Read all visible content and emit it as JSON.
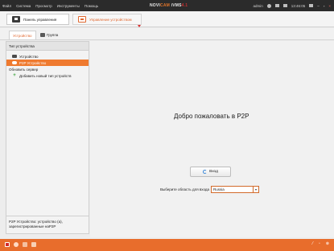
{
  "titlebar": {
    "menu": [
      "Файл",
      "Система",
      "Просмотр",
      "Инструменты",
      "Помощь"
    ],
    "brand": {
      "part1": "NOVI",
      "part2": "CAM",
      "part3": " iVMS",
      "part4": "4.1"
    },
    "user": "admin",
    "time": "13:46:05",
    "controls": {
      "min": "–",
      "max": "▫",
      "close": "×"
    }
  },
  "toolbar": {
    "tab_control_panel": "Панель управления",
    "tab_device_management": "Управление устройством"
  },
  "subtabs": {
    "device": "Устройство",
    "group": "Группа"
  },
  "leftpanel": {
    "header": "Тип устройства",
    "items": [
      {
        "label": "Устройство",
        "icon": "device-icon"
      },
      {
        "label": "P2P Устройство",
        "icon": "p2p-icon",
        "selected": true
      },
      {
        "label": "Обновить сервер",
        "icon": ""
      },
      {
        "label": "Добавить новый тип устройств",
        "icon": "plus-icon"
      }
    ],
    "footer": "P2P Устройство: устройство (а), зарегистрированные наP2P"
  },
  "main": {
    "welcome": "Добро пожаловать в P2P",
    "login_button": "Вход",
    "region_label": "Выберите область для входа",
    "region_value": "Russia"
  },
  "statusbar": {
    "right": [
      "⁄",
      "▫",
      "⊗"
    ]
  },
  "colors": {
    "accent": "#ef7a2f",
    "titlebar": "#2b2b2b",
    "statusbar": "#e86d2c"
  }
}
